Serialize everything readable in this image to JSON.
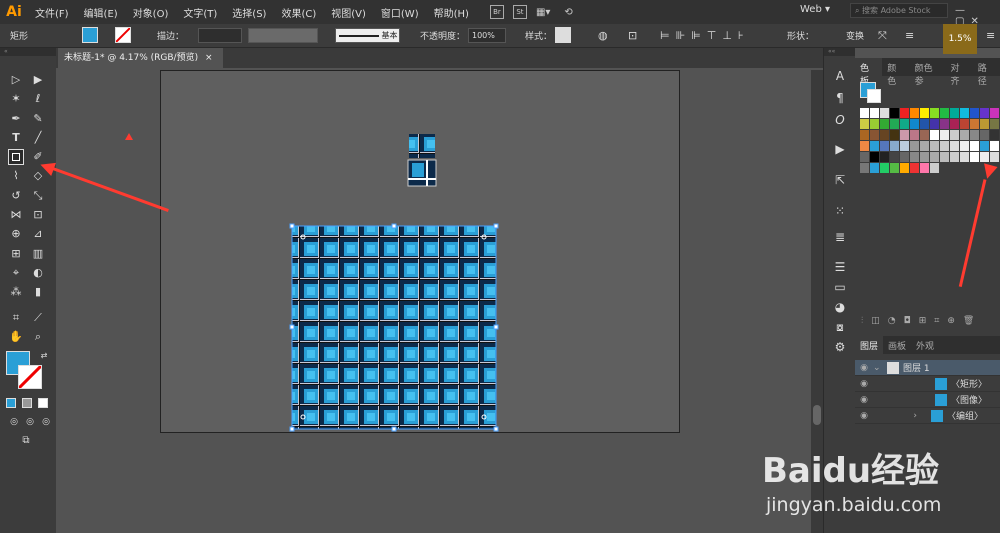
{
  "app": {
    "logo": "Ai"
  },
  "menu": [
    "文件(F)",
    "编辑(E)",
    "对象(O)",
    "文字(T)",
    "选择(S)",
    "效果(C)",
    "视图(V)",
    "窗口(W)",
    "帮助(H)"
  ],
  "menubar_icons": [
    "Br",
    "St"
  ],
  "workspace": "Web",
  "stock_search": {
    "placeholder": "搜索 Adobe Stock"
  },
  "control": {
    "shape_label": "矩形",
    "stroke_label": "描边：",
    "stroke_style": "基本",
    "opacity_label": "不透明度：",
    "opacity_value": "100%",
    "style_label": "样式：",
    "shape_btn": "形状：",
    "transform_btn": "变换"
  },
  "zoom_badge": "1.5%",
  "doc_tab": {
    "title": "未标题-1* @ 4.17% (RGB/预览)",
    "close": "×"
  },
  "panel_tabs": [
    "色板",
    "颜色",
    "颜色参",
    "对齐",
    "路径"
  ],
  "layers_tabs": [
    "图层",
    "画板",
    "外观"
  ],
  "layers": [
    {
      "name": "图层 1",
      "indent": 0
    },
    {
      "name": "〈矩形〉",
      "indent": 1
    },
    {
      "name": "〈图像〉",
      "indent": 1
    },
    {
      "name": "〈编组〉",
      "indent": 1
    }
  ],
  "watermark": {
    "brand": "Baidu经验",
    "url": "jingyan.baidu.com"
  },
  "colors": {
    "accent_arrow": "#ff3b30",
    "plaid_blue": "#2a9fd6",
    "zoom_bg": "#8a6a1a"
  }
}
